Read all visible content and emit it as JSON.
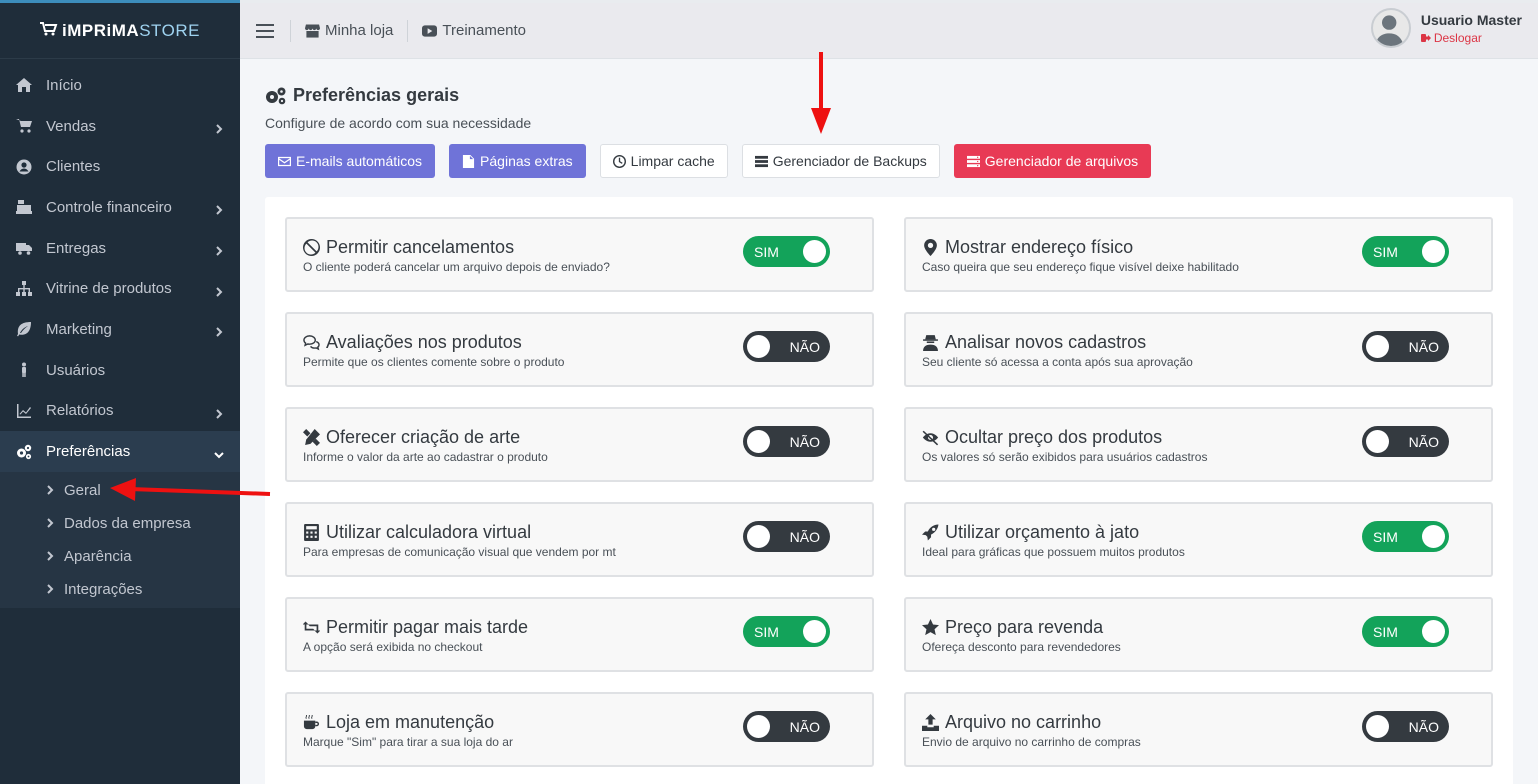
{
  "brand": {
    "part1": "iMPRiMA",
    "part2": "STORE"
  },
  "sidebar": {
    "items": [
      {
        "label": "Início",
        "icon": "home-icon",
        "expandable": false
      },
      {
        "label": "Vendas",
        "icon": "cart-icon",
        "expandable": true
      },
      {
        "label": "Clientes",
        "icon": "user-circle-icon",
        "expandable": false
      },
      {
        "label": "Controle financeiro",
        "icon": "cash-register-icon",
        "expandable": true
      },
      {
        "label": "Entregas",
        "icon": "truck-icon",
        "expandable": true
      },
      {
        "label": "Vitrine de produtos",
        "icon": "sitemap-icon",
        "expandable": true
      },
      {
        "label": "Marketing",
        "icon": "leaf-icon",
        "expandable": true
      },
      {
        "label": "Usuários",
        "icon": "person-icon",
        "expandable": false
      },
      {
        "label": "Relatórios",
        "icon": "chart-line-icon",
        "expandable": true
      },
      {
        "label": "Preferências",
        "icon": "cogs-icon",
        "expandable": true,
        "active": true
      }
    ],
    "submenu": [
      "Geral",
      "Dados da empresa",
      "Aparência",
      "Integrações"
    ]
  },
  "header": {
    "links": [
      {
        "label": "Minha loja",
        "icon": "store-icon"
      },
      {
        "label": "Treinamento",
        "icon": "youtube-icon"
      }
    ],
    "user": {
      "name": "Usuario Master",
      "logout": "Deslogar"
    }
  },
  "page": {
    "title": "Preferências gerais",
    "subtitle": "Configure de acordo com sua necessidade",
    "buttons": [
      {
        "label": "E-mails automáticos",
        "icon": "envelope-icon",
        "style": "purple"
      },
      {
        "label": "Páginas extras",
        "icon": "file-icon",
        "style": "purple"
      },
      {
        "label": "Limpar cache",
        "icon": "clock-icon",
        "style": "light"
      },
      {
        "label": "Gerenciador de Backups",
        "icon": "database-icon",
        "style": "light"
      },
      {
        "label": "Gerenciador de arquivos",
        "icon": "server-icon",
        "style": "danger"
      }
    ]
  },
  "toggle_labels": {
    "on": "SIM",
    "off": "NÃO"
  },
  "options": [
    {
      "title": "Permitir cancelamentos",
      "desc": "O cliente poderá cancelar um arquivo depois de enviado?",
      "icon": "ban-icon",
      "on": true
    },
    {
      "title": "Mostrar endereço físico",
      "desc": "Caso queira que seu endereço fique visível deixe habilitado",
      "icon": "map-marker-icon",
      "on": true
    },
    {
      "title": "Avaliações nos produtos",
      "desc": "Permite que os clientes comente sobre o produto",
      "icon": "comments-icon",
      "on": false
    },
    {
      "title": "Analisar novos cadastros",
      "desc": "Seu cliente só acessa a conta após sua aprovação",
      "icon": "user-secret-icon",
      "on": false
    },
    {
      "title": "Oferecer criação de arte",
      "desc": "Informe o valor da arte ao cadastrar o produto",
      "icon": "pencil-ruler-icon",
      "on": false
    },
    {
      "title": "Ocultar preço dos produtos",
      "desc": "Os valores só serão exibidos para usuários cadastros",
      "icon": "eye-slash-icon",
      "on": false
    },
    {
      "title": "Utilizar calculadora virtual",
      "desc": "Para empresas de comunicação visual que vendem por mt",
      "icon": "calculator-icon",
      "on": false
    },
    {
      "title": "Utilizar orçamento à jato",
      "desc": "Ideal para gráficas que possuem muitos produtos",
      "icon": "rocket-icon",
      "on": true
    },
    {
      "title": "Permitir pagar mais tarde",
      "desc": "A opção será exibida no checkout",
      "icon": "retweet-icon",
      "on": true
    },
    {
      "title": "Preço para revenda",
      "desc": "Ofereça desconto para revendedores",
      "icon": "star-icon",
      "on": true
    },
    {
      "title": "Loja em manutenção",
      "desc": "Marque \"Sim\" para tirar a sua loja do ar",
      "icon": "coffee-icon",
      "on": false
    },
    {
      "title": "Arquivo no carrinho",
      "desc": "Envio de arquivo no carrinho de compras",
      "icon": "upload-icon",
      "on": false
    }
  ]
}
